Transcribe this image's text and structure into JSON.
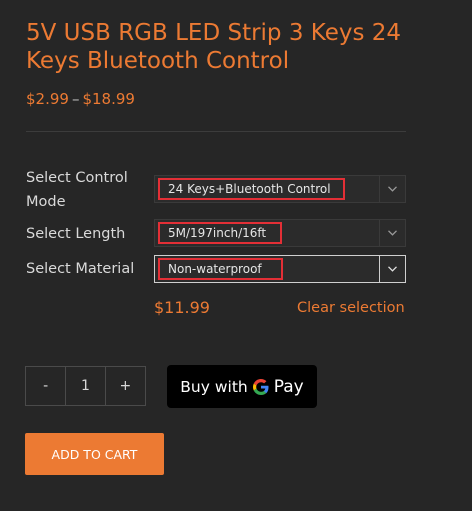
{
  "product": {
    "title": "5V USB RGB LED Strip 3 Keys 24 Keys Bluetooth Control",
    "price_min": "$2.99",
    "price_sep": "–",
    "price_max": "$18.99"
  },
  "options": [
    {
      "label": "Select Control Mode",
      "value": "24 Keys+Bluetooth Control",
      "chevron_icon": "chevron-down-icon"
    },
    {
      "label": "Select Length",
      "value": "5M/197inch/16ft",
      "chevron_icon": "chevron-down-icon"
    },
    {
      "label": "Select Material",
      "value": "Non-waterproof",
      "chevron_icon": "chevron-down-icon"
    }
  ],
  "variation": {
    "price": "$11.99",
    "clear_label": "Clear selection"
  },
  "quantity": {
    "minus_label": "-",
    "value": "1",
    "plus_label": "+"
  },
  "gpay": {
    "label": "Buy with",
    "g": "G",
    "pay": "Pay"
  },
  "add_to_cart": "ADD TO CART",
  "colors": {
    "accent": "#ec7a33",
    "background": "#262626",
    "highlight_border": "#e32f36"
  }
}
